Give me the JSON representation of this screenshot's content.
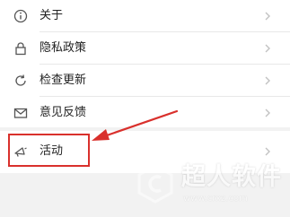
{
  "settings": {
    "items": [
      {
        "label": "关于",
        "icon": "info-icon"
      },
      {
        "label": "隐私政策",
        "icon": "lock-icon"
      },
      {
        "label": "检查更新",
        "icon": "refresh-icon"
      },
      {
        "label": "意见反馈",
        "icon": "mail-icon"
      }
    ],
    "activity": {
      "label": "活动",
      "icon": "megaphone-icon"
    }
  },
  "colors": {
    "background": "#f2f2f2",
    "card": "#ffffff",
    "text": "#222222",
    "icon": "#555555",
    "chevron": "#c2c2c2",
    "highlight": "#d9302c"
  },
  "watermark": {
    "title": "超人软件",
    "url": "www.crxz.com",
    "logo_icon": "logo-icon"
  }
}
